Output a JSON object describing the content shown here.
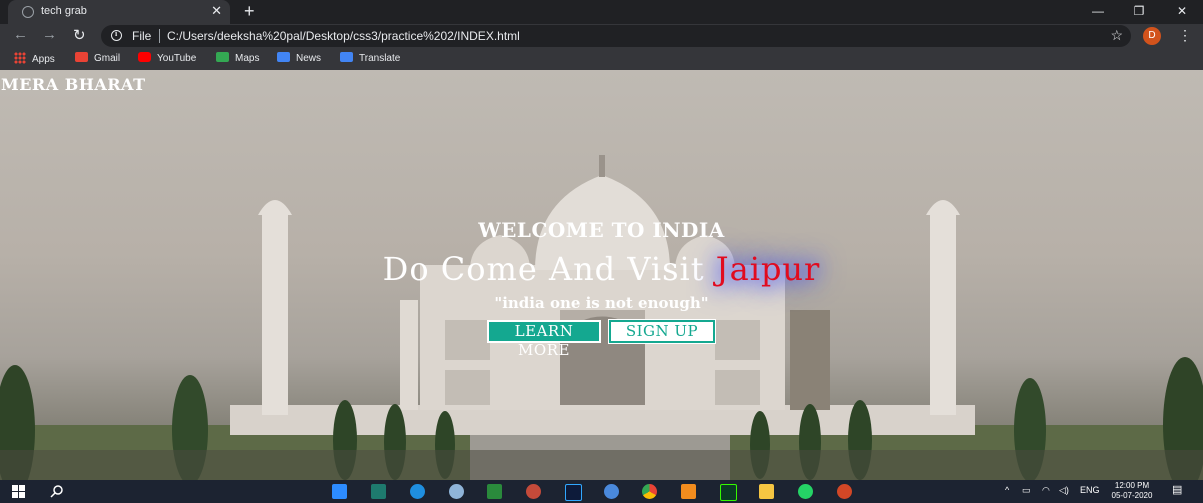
{
  "browser": {
    "tab_title": "tech grab",
    "tab_close": "✕",
    "new_tab": "+",
    "window_controls": {
      "minimize": "—",
      "restore": "❐",
      "close": "✕"
    },
    "nav": {
      "back": "←",
      "forward": "→",
      "reload": "↻"
    },
    "scheme_label": "File",
    "url": "C:/Users/deeksha%20pal/Desktop/css3/practice%202/INDEX.html",
    "star": "☆",
    "avatar_letter": "D",
    "menu": "⋮"
  },
  "bookmarks": [
    {
      "label": "Apps",
      "icon": "apps-grid-icon"
    },
    {
      "label": "Gmail",
      "icon": "gmail-icon",
      "color": "#ea4335"
    },
    {
      "label": "YouTube",
      "icon": "youtube-icon",
      "color": "#ff0000"
    },
    {
      "label": "Maps",
      "icon": "maps-icon",
      "color": "#34a853"
    },
    {
      "label": "News",
      "icon": "news-icon",
      "color": "#4285f4"
    },
    {
      "label": "Translate",
      "icon": "translate-icon",
      "color": "#4285f4"
    }
  ],
  "page": {
    "brand": "MERA BHARAT",
    "welcome": "WELCOME TO INDIA",
    "headline_prefix": "Do Come And Visit ",
    "headline_city": "Jaipur",
    "tagline": "\"india one is not enough\"",
    "learn_more": "LEARN MORE",
    "sign_up": "SIGN UP",
    "accent_color": "#14a890",
    "city_color": "#e10b1f"
  },
  "taskbar": {
    "apps": [
      "start-icon",
      "search-icon",
      "zoom-icon",
      "media-icon",
      "edge-icon",
      "weather-icon",
      "excel-icon",
      "paint-icon",
      "photoshop-icon",
      "cortana-icon",
      "chrome-icon",
      "sublime-icon",
      "dreamweaver-icon",
      "file-explorer-icon",
      "whatsapp-icon",
      "powerpoint-icon"
    ],
    "language": "ENG",
    "time": "12:00 PM",
    "date": "05-07-2020"
  }
}
